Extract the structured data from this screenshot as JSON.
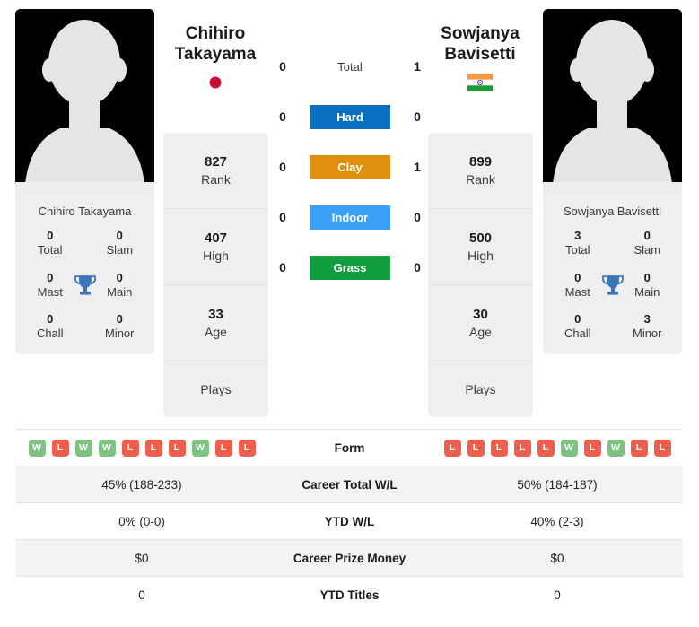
{
  "players": {
    "left": {
      "first_name": "Chihiro",
      "last_name": "Takayama",
      "full_name": "Chihiro Takayama",
      "flag": "jp-flag-icon",
      "rank": "827",
      "rank_label": "Rank",
      "high": "407",
      "high_label": "High",
      "age": "33",
      "age_label": "Age",
      "plays": "",
      "plays_label": "Plays",
      "titles": {
        "total": "0",
        "total_label": "Total",
        "slam": "0",
        "slam_label": "Slam",
        "mast": "0",
        "mast_label": "Mast",
        "main": "0",
        "main_label": "Main",
        "chall": "0",
        "chall_label": "Chall",
        "minor": "0",
        "minor_label": "Minor"
      },
      "form": [
        "W",
        "L",
        "W",
        "W",
        "L",
        "L",
        "L",
        "W",
        "L",
        "L"
      ],
      "career_wl": "45% (188-233)",
      "ytd_wl": "0% (0-0)",
      "career_prize_money": "$0",
      "ytd_titles": "0"
    },
    "right": {
      "first_name": "Sowjanya",
      "last_name": "Bavisetti",
      "full_name": "Sowjanya Bavisetti",
      "flag": "in-flag-icon",
      "rank": "899",
      "rank_label": "Rank",
      "high": "500",
      "high_label": "High",
      "age": "30",
      "age_label": "Age",
      "plays": "",
      "plays_label": "Plays",
      "titles": {
        "total": "3",
        "total_label": "Total",
        "slam": "0",
        "slam_label": "Slam",
        "mast": "0",
        "mast_label": "Mast",
        "main": "0",
        "main_label": "Main",
        "chall": "0",
        "chall_label": "Chall",
        "minor": "3",
        "minor_label": "Minor"
      },
      "form": [
        "L",
        "L",
        "L",
        "L",
        "L",
        "W",
        "L",
        "W",
        "L",
        "L"
      ],
      "career_wl": "50% (184-187)",
      "ytd_wl": "40% (2-3)",
      "career_prize_money": "$0",
      "ytd_titles": "0"
    }
  },
  "head_to_head": [
    {
      "label": "Total",
      "left": "0",
      "right": "1",
      "color": "none"
    },
    {
      "label": "Hard",
      "left": "0",
      "right": "0",
      "color": "#0b6fc0"
    },
    {
      "label": "Clay",
      "left": "0",
      "right": "1",
      "color": "#e0900a"
    },
    {
      "label": "Indoor",
      "left": "0",
      "right": "0",
      "color": "#3aa0f5"
    },
    {
      "label": "Grass",
      "left": "0",
      "right": "0",
      "color": "#0f9d3e"
    }
  ],
  "table": {
    "rows": [
      {
        "label": "Form"
      },
      {
        "label": "Career Total W/L"
      },
      {
        "label": "YTD W/L"
      },
      {
        "label": "Career Prize Money"
      },
      {
        "label": "YTD Titles"
      }
    ]
  },
  "colors": {
    "win_badge": "#7ec381",
    "loss_badge": "#ee5e4d",
    "hard": "#0b6fc0",
    "clay": "#e0900a",
    "indoor": "#3aa0f5",
    "grass": "#0f9d3e",
    "trophy": "#3b76bd",
    "card_bg": "#efefef",
    "jp_red": "#ca1039"
  }
}
